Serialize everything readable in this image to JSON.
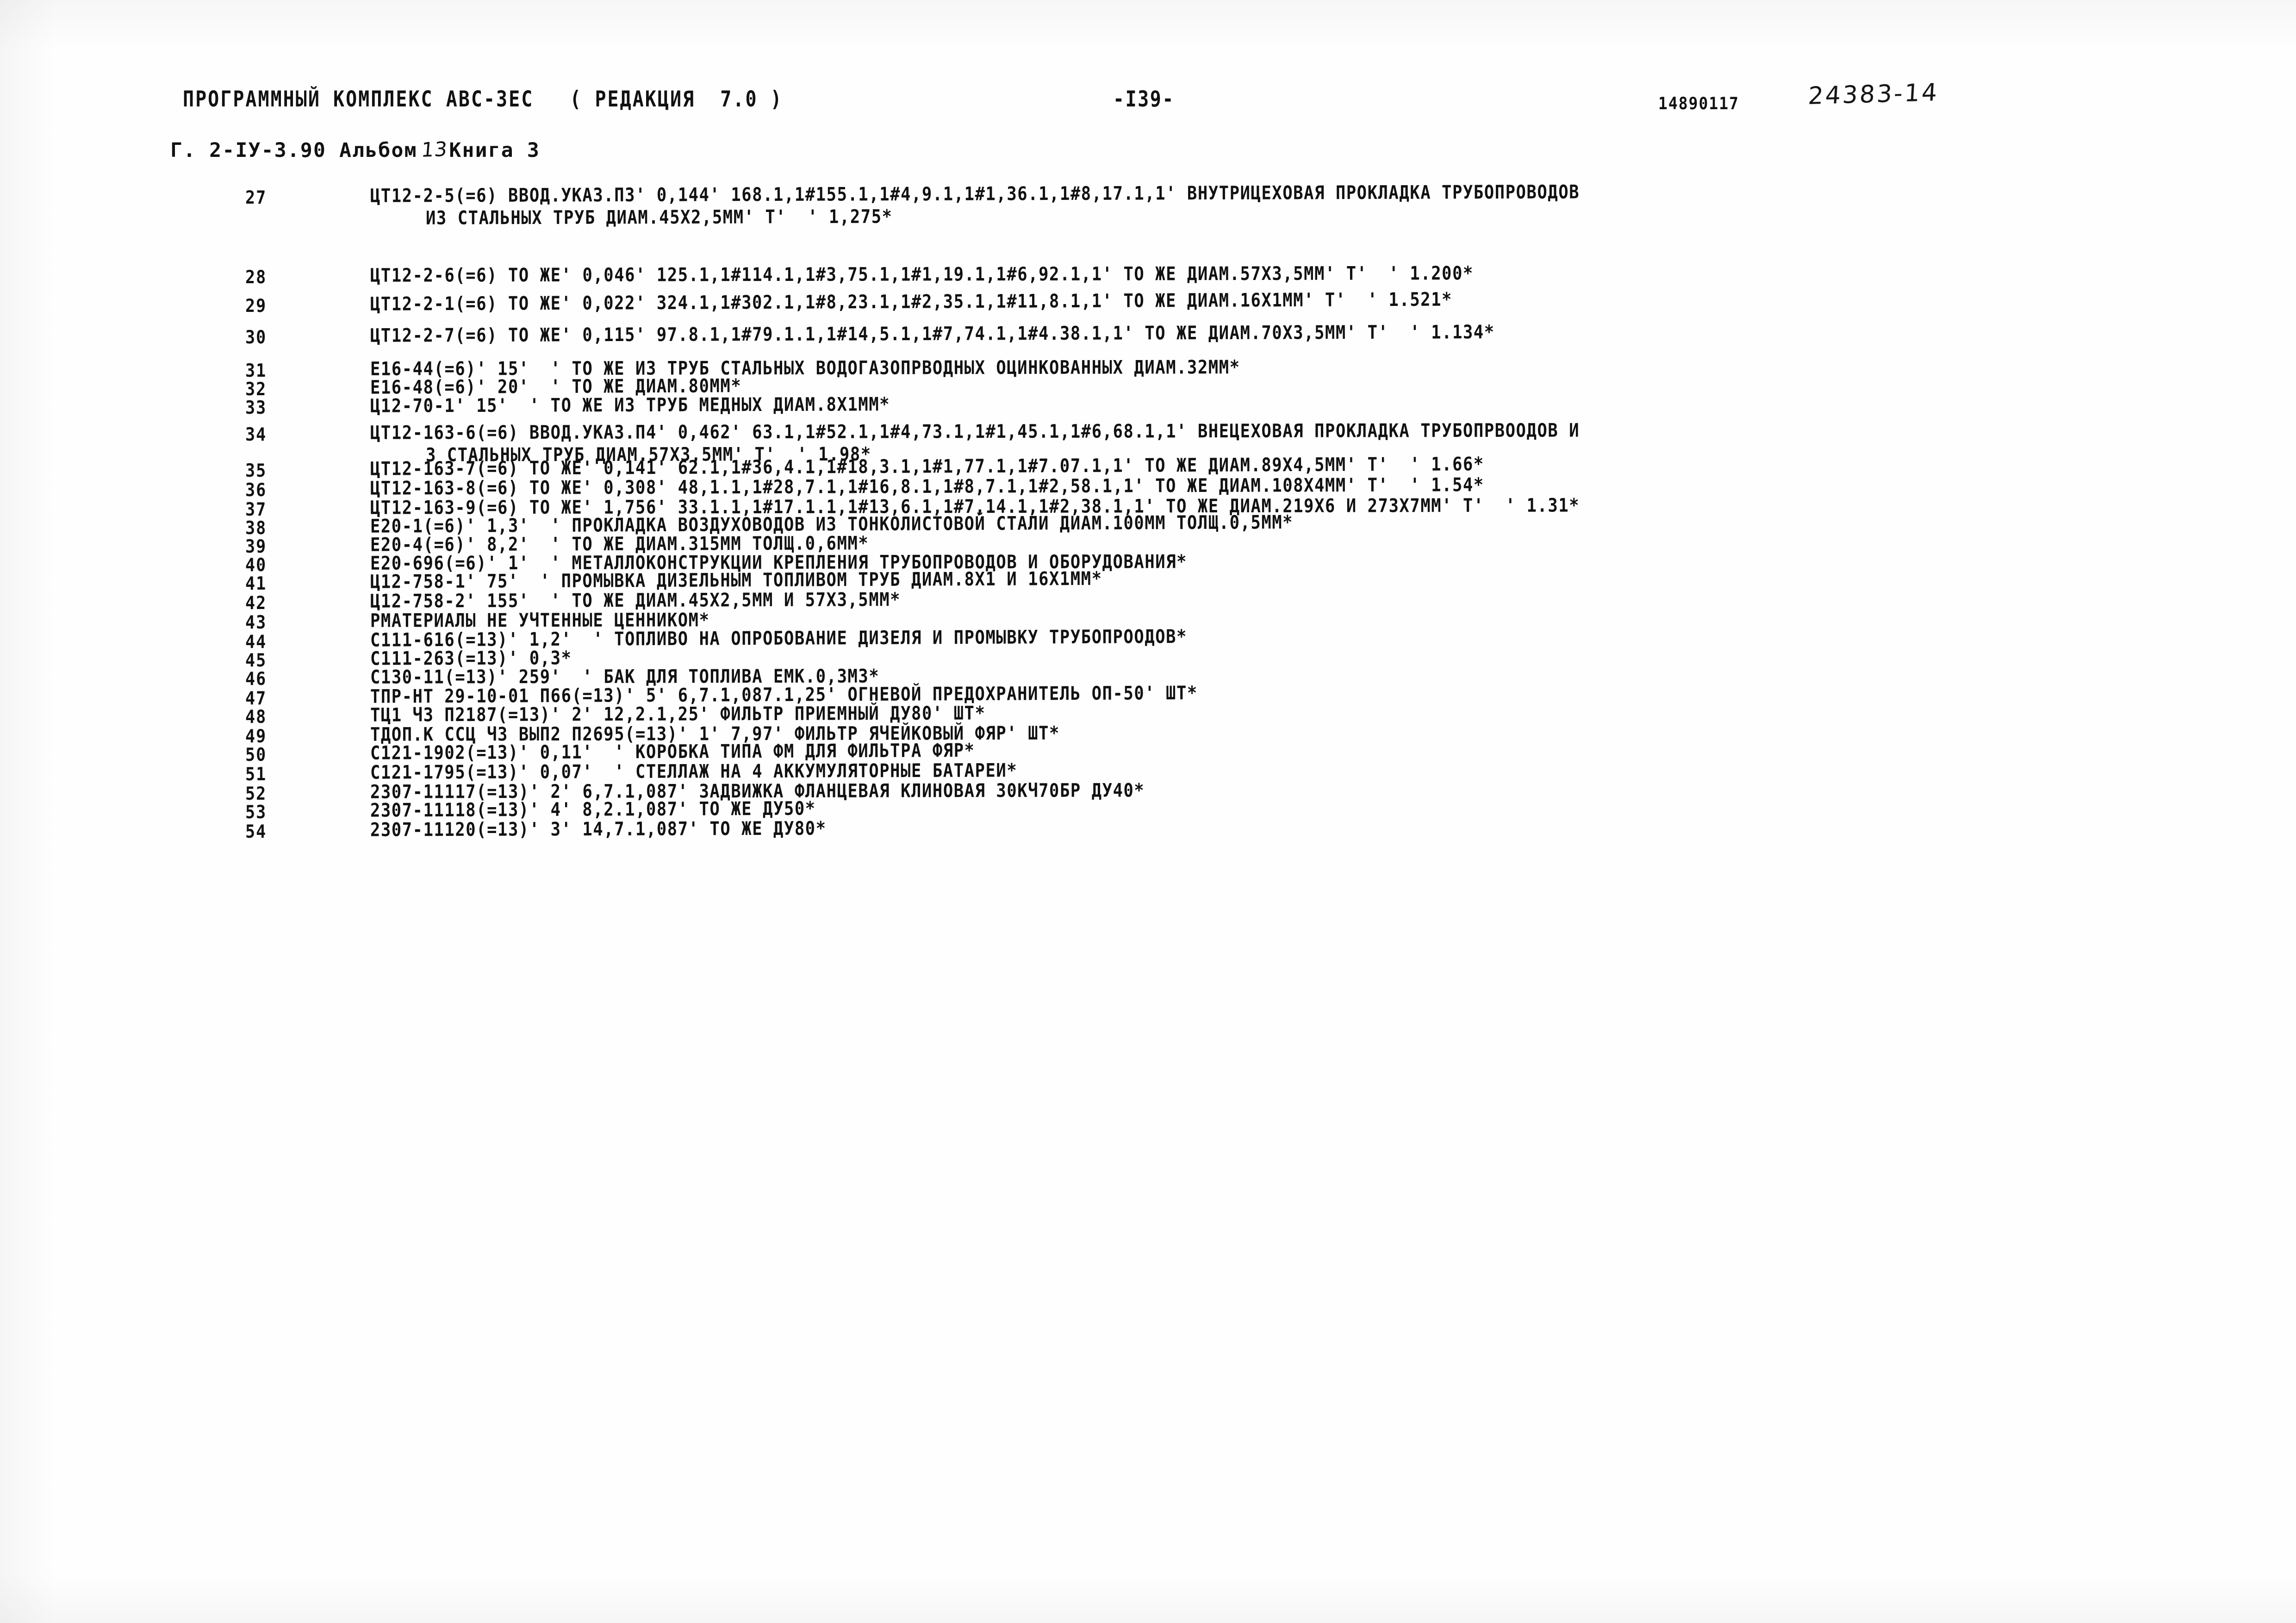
{
  "document": {
    "header": {
      "program_title": "ПРОГРАММНЫЙ КОМПЛЕКС АВС-3ЕС",
      "revision": "( РЕДАКЦИЯ  7.0 )",
      "page_marker": "-I39-",
      "doc_number": "14890117",
      "handwritten_stamp": "24383-14",
      "series_prefix": "Г. 2-IУ-3.90 Альбом",
      "album_number": "13",
      "book_label": "Книга 3"
    },
    "rows": [
      {
        "num": "27",
        "text": "ЦТ12-2-5(=6) ВВОД.УКАЗ.ПЗ' 0,144' 168.1,1#155.1,1#4,9.1,1#1,36.1,1#8,17.1,1' ВНУТРИЦЕХОВАЯ ПРОКЛАДКА ТРУБОПРОВОДОВ",
        "cont": "ИЗ СТАЛЬНЫХ ТРУБ ДИАМ.45Х2,5ММ' Т'  ' 1,275*"
      },
      {
        "num": "28",
        "text": "ЦТ12-2-6(=6) ТО ЖЕ' 0,046' 125.1,1#114.1,1#3,75.1,1#1,19.1,1#6,92.1,1' ТО ЖЕ ДИАМ.57Х3,5ММ' Т'  ' 1.200*",
        "cont": ""
      },
      {
        "num": "29",
        "text": "ЦТ12-2-1(=6) ТО ЖЕ' 0,022' 324.1,1#302.1,1#8,23.1,1#2,35.1,1#11,8.1,1' ТО ЖЕ ДИАМ.16Х1ММ' Т'  ' 1.521*",
        "cont": ""
      },
      {
        "num": "30",
        "text": "ЦТ12-2-7(=6) ТО ЖЕ' 0,115' 97.8.1,1#79.1.1,1#14,5.1,1#7,74.1,1#4.38.1,1' ТО ЖЕ ДИАМ.70Х3,5ММ' Т'  ' 1.134*",
        "cont": ""
      },
      {
        "num": "31",
        "text": "Е16-44(=6)' 15'  ' ТО ЖЕ ИЗ ТРУБ СТАЛЬНЫХ ВОДОГАЗОПРВОДНЫХ ОЦИНКОВАННЫХ ДИАМ.32ММ*",
        "cont": ""
      },
      {
        "num": "32",
        "text": "Е16-48(=6)' 20'  ' ТО ЖЕ ДИАМ.80ММ*",
        "cont": ""
      },
      {
        "num": "33",
        "text": "Ц12-70-1' 15'  ' ТО ЖЕ ИЗ ТРУБ МЕДНЫХ ДИАМ.8Х1ММ*",
        "cont": ""
      },
      {
        "num": "34",
        "text": "ЦТ12-163-6(=6) ВВОД.УКАЗ.П4' 0,462' 63.1,1#52.1,1#4,73.1,1#1,45.1,1#6,68.1,1' ВНЕЦЕХОВАЯ ПРОКЛАДКА ТРУБОПРВООДОВ И",
        "cont": "З СТАЛЬНЫХ ТРУБ ДИАМ.57Х3,5ММ' Т'  ' 1.98*"
      },
      {
        "num": "35",
        "text": "ЦТ12-163-7(=6) ТО ЖЕ' 0,141' 62.1,1#36,4.1,1#18,3.1,1#1,77.1,1#7.07.1,1' ТО ЖЕ ДИАМ.89Х4,5ММ' Т'  ' 1.66*",
        "cont": ""
      },
      {
        "num": "36",
        "text": "ЦТ12-163-8(=6) ТО ЖЕ' 0,308' 48,1.1,1#28,7.1,1#16,8.1,1#8,7.1,1#2,58.1,1' ТО ЖЕ ДИАМ.108Х4ММ' Т'  ' 1.54*",
        "cont": ""
      },
      {
        "num": "37",
        "text": "ЦТ12-163-9(=6) ТО ЖЕ' 1,756' 33.1.1,1#17.1.1,1#13,6.1,1#7,14.1,1#2,38.1,1' ТО ЖЕ ДИАМ.219Х6 И 273Х7ММ' Т'  ' 1.31*",
        "cont": ""
      },
      {
        "num": "38",
        "text": "Е20-1(=6)' 1,3'  ' ПРОКЛАДКА ВОЗДУХОВОДОВ ИЗ ТОНКОЛИСТОВОЙ СТАЛИ ДИАМ.100ММ ТОЛЩ.0,5ММ*",
        "cont": ""
      },
      {
        "num": "39",
        "text": "Е20-4(=6)' 8,2'  ' ТО ЖЕ ДИАМ.315ММ ТОЛЩ.0,6ММ*",
        "cont": ""
      },
      {
        "num": "40",
        "text": "Е20-696(=6)' 1'  ' МЕТАЛЛОКОНСТРУКЦИИ КРЕПЛЕНИЯ ТРУБОПРОВОДОВ И ОБОРУДОВАНИЯ*",
        "cont": ""
      },
      {
        "num": "41",
        "text": "Ц12-758-1' 75'  ' ПРОМЫВКА ДИЗЕЛЬНЫМ ТОПЛИВОМ ТРУБ ДИАМ.8Х1 И 16Х1ММ*",
        "cont": ""
      },
      {
        "num": "42",
        "text": "Ц12-758-2' 155'  ' ТО ЖЕ ДИАМ.45Х2,5ММ И 57Х3,5ММ*",
        "cont": ""
      },
      {
        "num": "43",
        "text": "РМАТЕРИАЛЫ НЕ УЧТЕННЫЕ ЦЕННИКОМ*",
        "cont": ""
      },
      {
        "num": "44",
        "text": "С111-616(=13)' 1,2'  ' ТОПЛИВО НА ОПРОБОВАНИЕ ДИЗЕЛЯ И ПРОМЫВКУ ТРУБОПРООДОВ*",
        "cont": ""
      },
      {
        "num": "45",
        "text": "С111-263(=13)' 0,3*",
        "cont": ""
      },
      {
        "num": "46",
        "text": "С130-11(=13)' 259'  ' БАК ДЛЯ ТОПЛИВА ЕМК.0,3М3*",
        "cont": ""
      },
      {
        "num": "47",
        "text": "ТПР-НТ 29-10-01 П66(=13)' 5' 6,7.1,087.1,25' ОГНЕВОЙ ПРЕДОХРАНИТЕЛЬ ОП-50' ШТ*",
        "cont": ""
      },
      {
        "num": "48",
        "text": "ТЦ1 Ч3 П2187(=13)' 2' 12,2.1,25' ФИЛЬТР ПРИЕМНЫЙ ДУ80' ШТ*",
        "cont": ""
      },
      {
        "num": "49",
        "text": "ТДОП.К ССЦ Ч3 ВЫП2 П2695(=13)' 1' 7,97' ФИЛЬТР ЯЧЕЙКОВЫЙ ФЯР' ШТ*",
        "cont": ""
      },
      {
        "num": "50",
        "text": "С121-1902(=13)' 0,11'  ' КОРОБКА ТИПА ФМ ДЛЯ ФИЛЬТРА ФЯР*",
        "cont": ""
      },
      {
        "num": "51",
        "text": "С121-1795(=13)' 0,07'  ' СТЕЛЛАЖ НА 4 АККУМУЛЯТОРНЫЕ БАТАРЕИ*",
        "cont": ""
      },
      {
        "num": "52",
        "text": "2307-11117(=13)' 2' 6,7.1,087' ЗАДВИЖКА ФЛАНЦЕВАЯ КЛИНОВАЯ 30КЧ70БР ДУ40*",
        "cont": ""
      },
      {
        "num": "53",
        "text": "2307-11118(=13)' 4' 8,2.1,087' ТО ЖЕ ДУ50*",
        "cont": ""
      },
      {
        "num": "54",
        "text": "2307-11120(=13)' 3' 14,7.1,087' ТО ЖЕ ДУ80*",
        "cont": ""
      }
    ]
  }
}
